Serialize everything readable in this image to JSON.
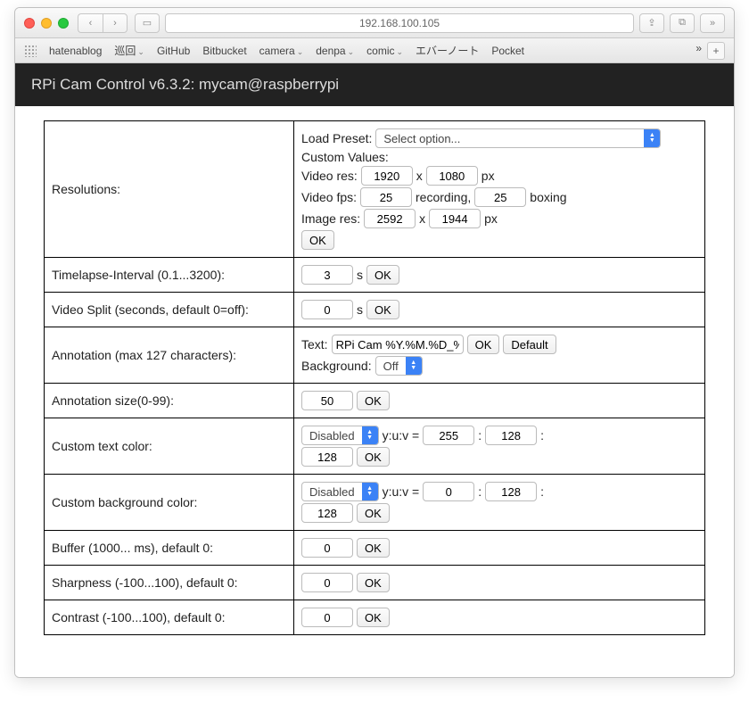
{
  "browser": {
    "url": "192.168.100.105",
    "bookmarks": [
      "hatenablog",
      "巡回",
      "GitHub",
      "Bitbucket",
      "camera",
      "denpa",
      "comic",
      "エバーノート",
      "Pocket"
    ]
  },
  "header": {
    "title": "RPi Cam Control v6.3.2: mycam@raspberrypi"
  },
  "labels": {
    "resolutions": "Resolutions:",
    "load_preset": "Load Preset:",
    "select_option": "Select option...",
    "custom_values": "Custom Values:",
    "video_res": "Video res:",
    "px": "px",
    "video_fps": "Video fps:",
    "recording": "recording,",
    "boxing": "boxing",
    "image_res": "Image res:",
    "ok": "OK",
    "default": "Default",
    "x": "x",
    "s": "s",
    "timelapse": "Timelapse-Interval (0.1...3200):",
    "video_split": "Video Split (seconds, default 0=off):",
    "annotation": "Annotation (max 127 characters):",
    "text": "Text:",
    "background": "Background:",
    "off": "Off",
    "disabled": "Disabled",
    "annotation_size": "Annotation size(0-99):",
    "custom_text_color": "Custom text color:",
    "custom_bg_color": "Custom background color:",
    "yuv": "y:u:v =",
    "colon": ":",
    "buffer": "Buffer (1000... ms), default 0:",
    "sharpness": "Sharpness (-100...100), default 0:",
    "contrast": "Contrast (-100...100), default 0:"
  },
  "values": {
    "video_w": "1920",
    "video_h": "1080",
    "fps_rec": "25",
    "fps_box": "25",
    "image_w": "2592",
    "image_h": "1944",
    "timelapse": "3",
    "video_split": "0",
    "annotation_text": "RPi Cam %Y.%M.%D_%",
    "annotation_size": "50",
    "txt_y": "255",
    "txt_u": "128",
    "txt_v": "128",
    "bg_y": "0",
    "bg_u": "128",
    "bg_v": "128",
    "buffer": "0",
    "sharpness": "0",
    "contrast": "0"
  }
}
